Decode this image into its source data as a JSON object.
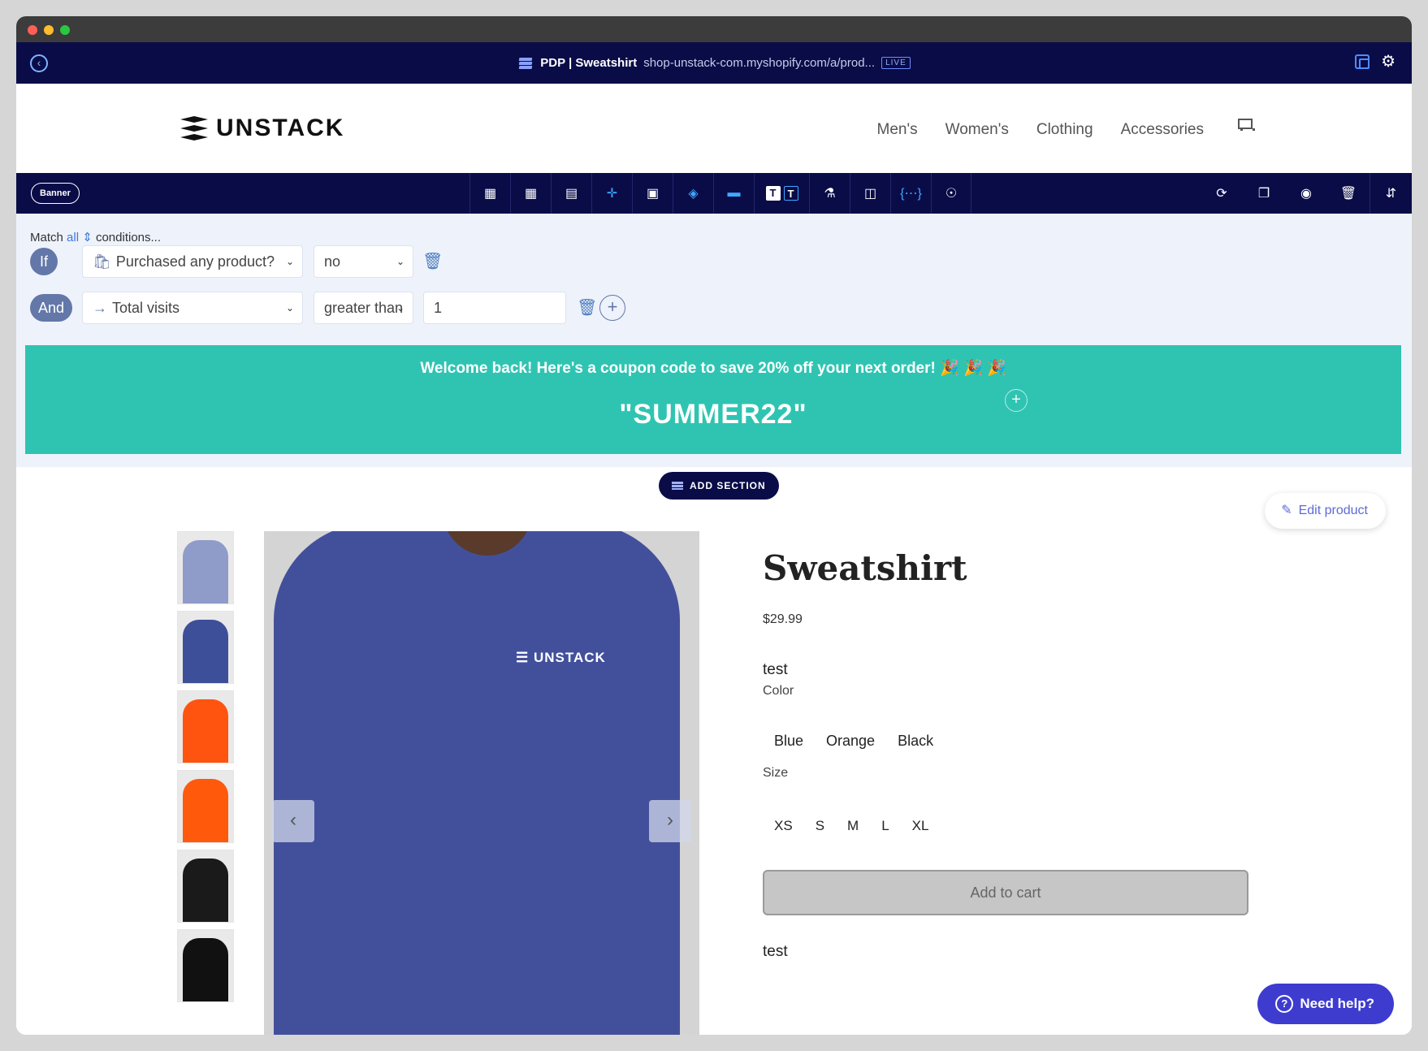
{
  "editor": {
    "page_name": "PDP | Sweatshirt",
    "page_url": "shop-unstack-com.myshopify.com/a/prod...",
    "live_badge": "LIVE"
  },
  "site": {
    "logo_text": "UNSTACK",
    "nav": [
      "Men's",
      "Women's",
      "Clothing",
      "Accessories"
    ]
  },
  "section_toolbar": {
    "section_type": "Banner"
  },
  "conditions": {
    "match_prefix": "Match",
    "match_value": "all",
    "match_suffix": "conditions...",
    "rows": [
      {
        "connector": "If",
        "field": "Purchased any product?",
        "operator": "no",
        "value": ""
      },
      {
        "connector": "And",
        "field": "Total visits",
        "operator": "greater than",
        "value": "1"
      }
    ]
  },
  "banner": {
    "message": "Welcome back! Here's a coupon code to save 20% off your next order! 🎉 🎉 🎉",
    "code": "\"SUMMER22\""
  },
  "buttons": {
    "add_section": "ADD SECTION",
    "edit_product": "Edit product",
    "need_help": "Need help?"
  },
  "product": {
    "title": "Sweatshirt",
    "price": "$29.99",
    "description": "test",
    "color_label": "Color",
    "colors": [
      "Blue",
      "Orange",
      "Black"
    ],
    "size_label": "Size",
    "sizes": [
      "XS",
      "S",
      "M",
      "L",
      "XL"
    ],
    "add_to_cart": "Add to cart",
    "description_2": "test",
    "photo_logo": "UNSTACK",
    "thumbnail_colors": [
      "#8f9cc9",
      "#3e4f9a",
      "#ff5410",
      "#ff5a0c",
      "#1a1a1a",
      "#111111"
    ]
  },
  "colors": {
    "editor_navy": "#0a0c48",
    "banner_teal": "#2fc4b2",
    "help_purple": "#3e3ccf"
  }
}
